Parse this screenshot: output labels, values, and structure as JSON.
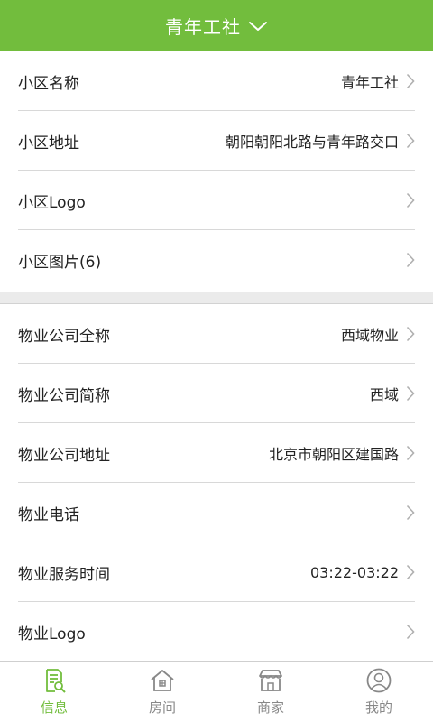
{
  "header": {
    "title": "青年工社",
    "dropdown_icon": "chevron-down-icon"
  },
  "colors": {
    "accent": "#72bd3d",
    "text": "#222222",
    "inactive": "#888888",
    "divider": "#d8d8d8",
    "section_gap": "#ebebeb"
  },
  "community": {
    "name_label": "小区名称",
    "name_value": "青年工社",
    "address_label": "小区地址",
    "address_value": "朝阳朝阳北路与青年路交口",
    "logo_label": "小区Logo",
    "photos_label": "小区图片(6)"
  },
  "property": {
    "fullname_label": "物业公司全称",
    "fullname_value": "西域物业",
    "shortname_label": "物业公司简称",
    "shortname_value": "西域",
    "address_label": "物业公司地址",
    "address_value": "北京市朝阳区建国路",
    "phone_label": "物业电话",
    "hours_label": "物业服务时间",
    "hours_value": "03:22-03:22",
    "logo_label": "物业Logo"
  },
  "tabs": [
    {
      "label": "信息",
      "icon": "info-document-search-icon",
      "active": true
    },
    {
      "label": "房间",
      "icon": "house-icon",
      "active": false
    },
    {
      "label": "商家",
      "icon": "store-icon",
      "active": false
    },
    {
      "label": "我的",
      "icon": "user-profile-icon",
      "active": false
    }
  ]
}
